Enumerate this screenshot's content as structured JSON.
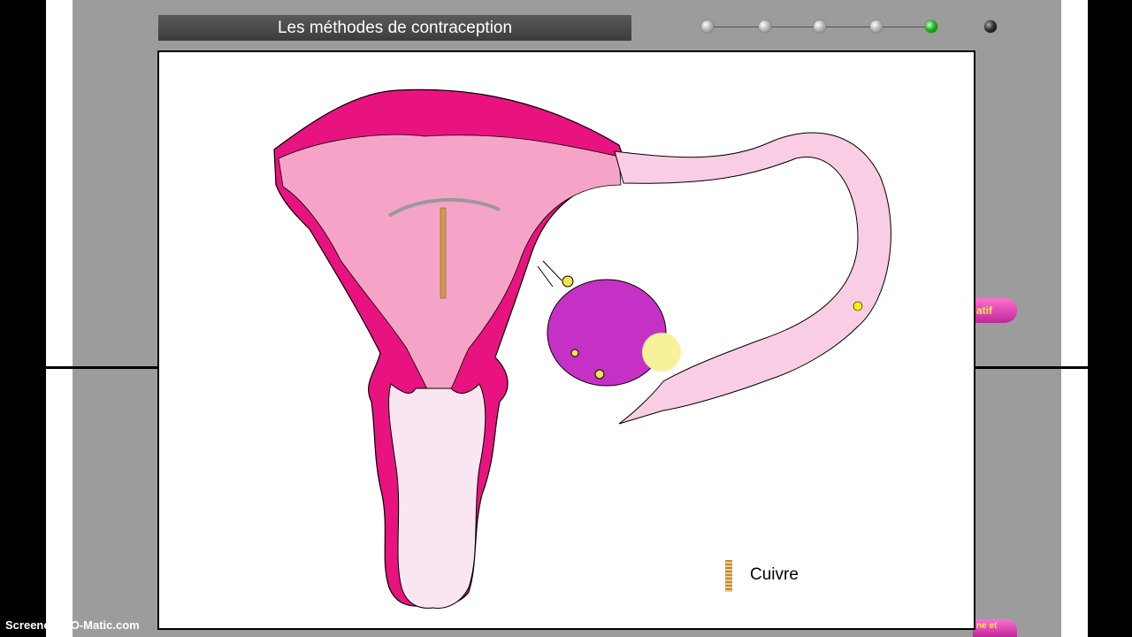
{
  "title": "Les méthodes de contraception",
  "navigation": {
    "steps": [
      "step-1",
      "step-2",
      "step-3",
      "step-4",
      "step-5"
    ],
    "active_step": 5
  },
  "side_buttons": [
    {
      "label": "atif"
    },
    {
      "label": "ne et"
    }
  ],
  "legend": {
    "label": "Cuivre",
    "swatch_color": "#d39a4a"
  },
  "watermark": "Screencast-O-Matic.com",
  "colors": {
    "uterus_wall": "#e8137f",
    "endometrium": "#f6a3c8",
    "tube": "#f9cde3",
    "ovary": "#c531c5",
    "egg": "#f7f29a",
    "background_panel": "#9c9c9c"
  }
}
